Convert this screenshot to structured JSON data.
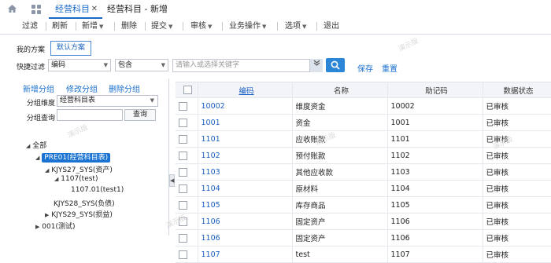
{
  "tabs": {
    "tab1": "经营科目",
    "tab1_close": "✕",
    "tab2": "经营科目 - 新增"
  },
  "toolbar": {
    "filter": "过滤",
    "refresh": "刷新",
    "add": "新增",
    "delete": "删除",
    "submit": "提交",
    "audit": "审核",
    "business": "业务操作",
    "options": "选项",
    "exit": "退出"
  },
  "scheme": {
    "label": "我的方案",
    "default_button": "默认方案"
  },
  "quick_filter": {
    "label": "快捷过滤",
    "field": "编码",
    "operator": "包含",
    "placeholder": "请输入或选择关键字",
    "save": "保存",
    "reset": "重置"
  },
  "group": {
    "add": "新增分组",
    "edit": "修改分组",
    "delete": "删除分组",
    "dimension_label": "分组维度",
    "dimension_value": "经营科目表",
    "query_label": "分组查询",
    "query_button": "查询"
  },
  "tree": {
    "all": "全部",
    "pre01": "PRE01(经营科目表)",
    "kjys27": "KJYS27_SYS(资产)",
    "n1107": "1107(test)",
    "n110701": "1107.01(test1)",
    "kjys28": "KJYS28_SYS(负债)",
    "kjys29": "KJYS29_SYS(损益)",
    "n001": "001(测试)"
  },
  "grid": {
    "headers": {
      "code": "编码",
      "name": "名称",
      "mnemonic": "助记码",
      "status": "数据状态"
    },
    "rows": [
      {
        "code": "10002",
        "name": "维度资金",
        "mnemonic": "10002",
        "status": "已审核"
      },
      {
        "code": "1001",
        "name": "资金",
        "mnemonic": "1001",
        "status": "已审核"
      },
      {
        "code": "1101",
        "name": "应收账款",
        "mnemonic": "1101",
        "status": "已审核"
      },
      {
        "code": "1102",
        "name": "预付账款",
        "mnemonic": "1102",
        "status": "已审核"
      },
      {
        "code": "1103",
        "name": "其他应收款",
        "mnemonic": "1103",
        "status": "已审核"
      },
      {
        "code": "1104",
        "name": "原材料",
        "mnemonic": "1104",
        "status": "已审核"
      },
      {
        "code": "1105",
        "name": "库存商品",
        "mnemonic": "1105",
        "status": "已审核"
      },
      {
        "code": "1106",
        "name": "固定资产",
        "mnemonic": "1106",
        "status": "已审核"
      },
      {
        "code": "1106",
        "name": "固定资产",
        "mnemonic": "1106",
        "status": "已审核"
      },
      {
        "code": "1107",
        "name": "test",
        "mnemonic": "1107",
        "status": "已审核"
      }
    ]
  },
  "watermark": "演示版",
  "icons": {
    "home": "home-icon",
    "apps": "apps-icon",
    "search": "search-icon"
  },
  "colors": {
    "accent": "#1a73d2",
    "link": "#1a6fcc"
  }
}
